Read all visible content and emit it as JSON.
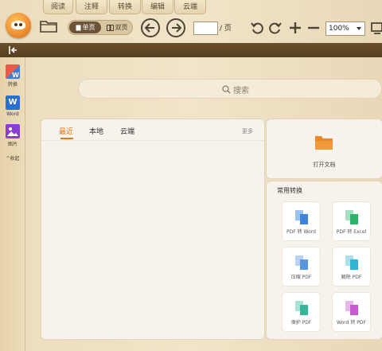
{
  "tabs": [
    "阅读",
    "注释",
    "转换",
    "编辑",
    "云端"
  ],
  "toolbar": {
    "single_page": "单页",
    "double_page": "双页",
    "page_input": "",
    "page_suffix": "/ 页",
    "zoom": "100%"
  },
  "sidebar": {
    "items": [
      {
        "label": "转换",
        "icon": "convert-icon"
      },
      {
        "label": "Word",
        "icon": "word-icon"
      },
      {
        "label": "图片",
        "icon": "image-icon"
      },
      {
        "label": "^收起",
        "icon": "collapse-icon"
      }
    ]
  },
  "search": {
    "placeholder": "搜索"
  },
  "recent": {
    "tabs": [
      "最近",
      "本地",
      "云端"
    ],
    "more": "更多"
  },
  "open": {
    "label": "打开文档"
  },
  "convert": {
    "title": "常用转换",
    "items": [
      "PDF 转 Word",
      "PDF 转 Excel",
      "压缩 PDF",
      "解除 PDF",
      "保护 PDF",
      "Word 转 PDF"
    ]
  },
  "colors": {
    "accent": "#e07a1f",
    "bar": "#5b4322",
    "panel": "#f7f3ec"
  }
}
